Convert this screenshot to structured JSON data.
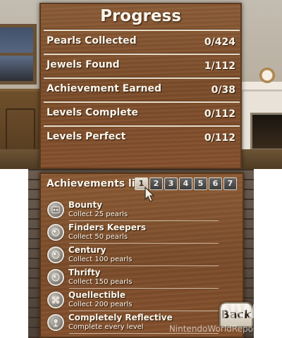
{
  "progress": {
    "title": "Progress",
    "rows": [
      {
        "label": "Pearls Collected",
        "value": "0/424"
      },
      {
        "label": "Jewels Found",
        "value": "1/112"
      },
      {
        "label": "Achievement Earned",
        "value": "0/38"
      },
      {
        "label": "Levels Complete",
        "value": "0/112"
      },
      {
        "label": "Levels Perfect",
        "value": "0/112"
      }
    ]
  },
  "achievements": {
    "header": "Achievements list",
    "pages": [
      "1",
      "2",
      "3",
      "4",
      "5",
      "6",
      "7"
    ],
    "active_page": "1",
    "items": [
      {
        "title": "Bounty",
        "description": "Collect 25 pearls",
        "icon": "pearl-pile-icon"
      },
      {
        "title": "Finders Keepers",
        "description": "Collect 50 pearls",
        "icon": "pearl-icon"
      },
      {
        "title": "Century",
        "description": "Collect 100 pearls",
        "icon": "pearl-icon"
      },
      {
        "title": "Thrifty",
        "description": "Collect 150 pearls",
        "icon": "pearl-icon"
      },
      {
        "title": "Quellectible",
        "description": "Collect 200 pearls",
        "icon": "pearl-cluster-icon"
      },
      {
        "title": "Completely Reflective",
        "description": "Complete every level",
        "icon": "pearl-trophy-icon"
      }
    ]
  },
  "back_button": {
    "label": "Back"
  },
  "watermark": {
    "logo": "NWR",
    "text": "NintendoWorldReport.com"
  },
  "colors": {
    "wood": "#7b4c2a",
    "text": "#fbf6ec",
    "divider": "#e8ddcb"
  }
}
